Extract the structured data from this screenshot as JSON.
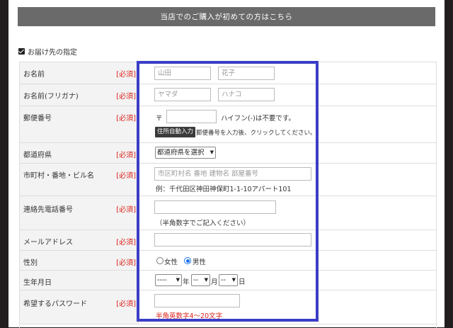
{
  "banner": "当店でのご購入が初めての方はこちら",
  "ship_checkbox": "お届け先の指定",
  "required": "[必須]",
  "rows": {
    "name": {
      "label": "お名前",
      "last_ph": "山田",
      "first_ph": "花子"
    },
    "kana": {
      "label": "お名前(フリガナ)",
      "last_ph": "ヤマダ",
      "first_ph": "ハナコ"
    },
    "zip": {
      "label": "郵便番号",
      "prefix": "〒",
      "hint": "ハイフン(-)は不要です。",
      "button": "住所自動入力",
      "button_hint": "郵便番号を入力後、クリックしてください。"
    },
    "pref": {
      "label": "都道府県",
      "select": "都道府県を選択"
    },
    "city": {
      "label": "市町村・番地・ビル名",
      "ph": "市区町村名 番地 建物名 部屋番号",
      "example": "例：千代田区神田神保町1-1-10アパート101"
    },
    "tel": {
      "label": "連絡先電話番号",
      "hint": "（半角数字でご記入ください）"
    },
    "email": {
      "label": "メールアドレス"
    },
    "gender": {
      "label": "性別",
      "female": "女性",
      "male": "男性"
    },
    "birth": {
      "label": "生年月日",
      "year_val": "----",
      "year": "年",
      "month_val": "--",
      "month": "月",
      "day_val": "--",
      "day": "日"
    },
    "password": {
      "label": "希望するパスワード",
      "hint": "半角英数字4～20文字"
    }
  },
  "colors": {
    "required": "#d9231b",
    "highlight": "#3b3ec6",
    "banner": "#6a6a6a"
  }
}
